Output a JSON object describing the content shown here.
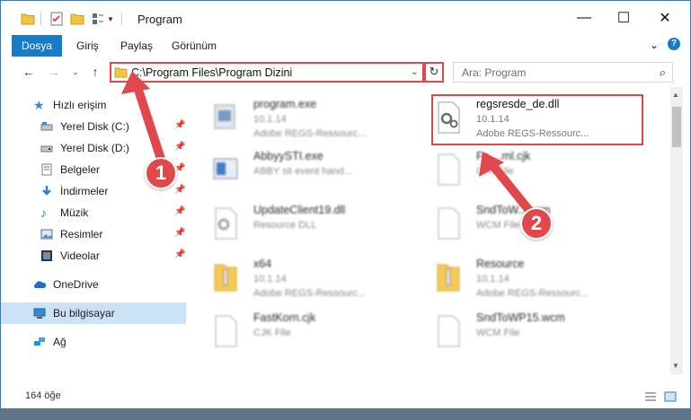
{
  "window": {
    "title": "Program",
    "buttons": [
      "minimize",
      "maximize",
      "close"
    ]
  },
  "ribbon": {
    "tabs": [
      "Dosya",
      "Giriş",
      "Paylaş",
      "Görünüm"
    ],
    "active_tab": "Dosya"
  },
  "navigation": {
    "address": "C:\\Program Files\\Program Dizini",
    "search_placeholder": "Ara: Program"
  },
  "sidebar": {
    "items": [
      {
        "label": "Hızlı erişim",
        "icon": "star-icon",
        "pinned": false
      },
      {
        "label": "Yerel Disk (C:)",
        "icon": "drive-icon",
        "pinned": true
      },
      {
        "label": "Yerel Disk (D:)",
        "icon": "drive-icon",
        "pinned": true
      },
      {
        "label": "Belgeler",
        "icon": "documents-icon",
        "pinned": true
      },
      {
        "label": "İndirmeler",
        "icon": "download-icon",
        "pinned": true
      },
      {
        "label": "Müzik",
        "icon": "music-icon",
        "pinned": true
      },
      {
        "label": "Resimler",
        "icon": "pictures-icon",
        "pinned": true
      },
      {
        "label": "Videolar",
        "icon": "videos-icon",
        "pinned": true
      },
      {
        "label": "OneDrive",
        "icon": "cloud-icon",
        "pinned": false
      },
      {
        "label": "Bu bilgisayar",
        "icon": "computer-icon",
        "pinned": false,
        "selected": true
      },
      {
        "label": "Ağ",
        "icon": "network-icon",
        "pinned": false
      }
    ]
  },
  "files": [
    {
      "name": "program.exe",
      "line1": "10.1.14",
      "line2": "Adobe REGS-Ressourc...",
      "icon": "exe-icon"
    },
    {
      "name": "regsresde_de.dll",
      "line1": "10.1.14",
      "line2": "Adobe REGS-Ressourc...",
      "icon": "dll-icon",
      "highlighted": true
    },
    {
      "name": "AbbyySTI.exe",
      "line1": "ABBY sti event hand...",
      "line2": "",
      "icon": "exe-icon"
    },
    {
      "name": "Fe....ml.cjk",
      "line1": "CJK File",
      "line2": "",
      "icon": "file-icon"
    },
    {
      "name": "UpdateClient19.dll",
      "line1": "Resource DLL",
      "line2": "",
      "icon": "dll-icon"
    },
    {
      "name": "SndToW...wcm",
      "line1": "WCM File",
      "line2": "",
      "icon": "file-icon"
    },
    {
      "name": "x64",
      "line1": "10.1.14",
      "line2": "Adobe REGS-Ressourc...",
      "icon": "folder-zip-icon"
    },
    {
      "name": "Resource",
      "line1": "10.1.14",
      "line2": "Adobe REGS-Ressourc...",
      "icon": "folder-zip-icon"
    },
    {
      "name": "FastKorn.cjk",
      "line1": "CJK File",
      "line2": "",
      "icon": "file-icon"
    },
    {
      "name": "SndToWP15.wcm",
      "line1": "WCM File",
      "line2": "",
      "icon": "file-icon"
    }
  ],
  "status": {
    "item_count": "164 öğe"
  },
  "annotations": {
    "step1": "1",
    "step2": "2",
    "color": "#e0484b"
  }
}
